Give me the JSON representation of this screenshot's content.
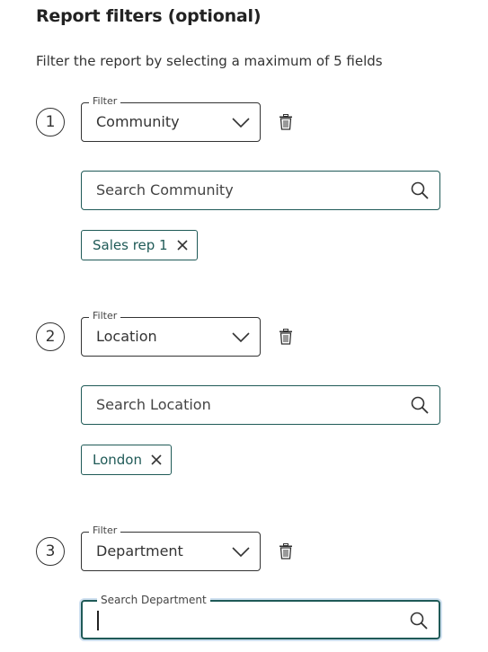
{
  "header": {
    "title": "Report filters (optional)",
    "subtitle": "Filter the report by selecting a maximum of 5 fields"
  },
  "filters": [
    {
      "number": "1",
      "legend": "Filter",
      "value": "Community",
      "search_placeholder": "Search Community",
      "chip": "Sales rep 1"
    },
    {
      "number": "2",
      "legend": "Filter",
      "value": "Location",
      "search_placeholder": "Search Location",
      "chip": "London"
    },
    {
      "number": "3",
      "legend": "Filter",
      "value": "Department",
      "search_label": "Search Department",
      "search_value": ""
    }
  ],
  "colors": {
    "accent": "#1f5a57",
    "text": "#222222"
  },
  "icons": {
    "dropdown": "chevron-down-icon",
    "delete": "trash-icon",
    "search": "search-icon",
    "remove_chip": "close-icon"
  }
}
